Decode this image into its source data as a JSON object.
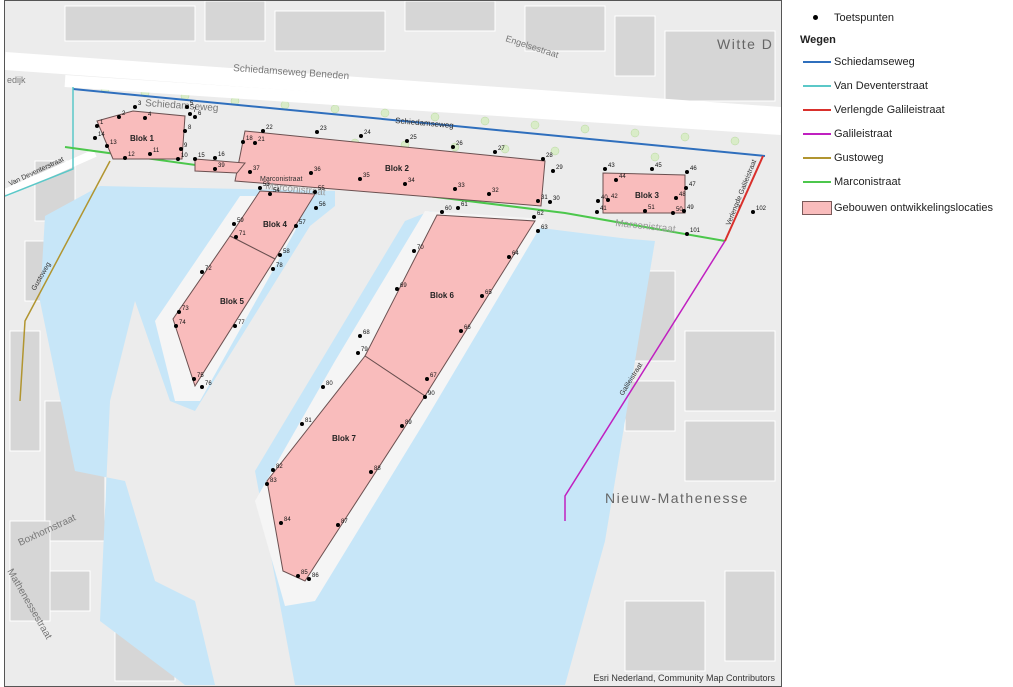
{
  "map": {
    "attribution": "Esri Nederland, Community Map Contributors",
    "area_labels": [
      "Witte D",
      "Nieuw-Mathenesse"
    ],
    "street_labels": {
      "schiedamseweg_beneden": "Schiedamseweg Beneden",
      "schiedamseweg": "Schiedamseweg",
      "schiedamseweg_route": "Schiedamseweg",
      "engelsestraat": "Engelsestraat",
      "van_deventerstraat": "Van Deventerstraat",
      "gustoweg": "Gustoweg",
      "marconistraat": "Marconistraat",
      "marconistraat2": "Marconistraat",
      "marconistraat3": "Marconistraat",
      "galileistraat": "Galileistraat",
      "verlengde_galileistraat": "Verlengde Galileistraat",
      "boxhornstraat": "Boxhornstraat",
      "mathenessestraat": "Mathenessestraat",
      "dijk": "edijk"
    },
    "buildings": [
      {
        "name": "Blok 1"
      },
      {
        "name": "Blok 2"
      },
      {
        "name": "Blok 3"
      },
      {
        "name": "Blok 4"
      },
      {
        "name": "Blok 5"
      },
      {
        "name": "Blok 6"
      },
      {
        "name": "Blok 7"
      }
    ],
    "test_points": [
      "1",
      "2",
      "3",
      "4",
      "5",
      "6",
      "7",
      "8",
      "9",
      "10",
      "11",
      "12",
      "13",
      "14",
      "15",
      "16",
      "18",
      "21",
      "22",
      "23",
      "24",
      "25",
      "26",
      "27",
      "28",
      "29",
      "30",
      "31",
      "32",
      "33",
      "34",
      "35",
      "36",
      "37",
      "39",
      "40",
      "41",
      "42",
      "43",
      "44",
      "45",
      "46",
      "47",
      "48",
      "49",
      "50",
      "51",
      "53",
      "54",
      "55",
      "56",
      "57",
      "58",
      "59",
      "60",
      "61",
      "62",
      "63",
      "64",
      "65",
      "66",
      "67",
      "68",
      "69",
      "70",
      "71",
      "72",
      "73",
      "74",
      "75",
      "76",
      "77",
      "78",
      "79",
      "80",
      "81",
      "82",
      "83",
      "84",
      "85",
      "86",
      "87",
      "88",
      "89",
      "90",
      "101",
      "102"
    ]
  },
  "legend": {
    "test_points": "Toetspunten",
    "roads_header": "Wegen",
    "roads": [
      {
        "label": "Schiedamseweg",
        "color": "#2f6fbd"
      },
      {
        "label": "Van Deventerstraat",
        "color": "#5bc8c8"
      },
      {
        "label": "Verlengde Galileistraat",
        "color": "#d9302c"
      },
      {
        "label": "Galileistraat",
        "color": "#c020c0"
      },
      {
        "label": "Gustoweg",
        "color": "#b19530"
      },
      {
        "label": "Marconistraat",
        "color": "#4cc74c"
      }
    ],
    "buildings": "Gebouwen ontwikkelingslocaties",
    "building_color": "#f9bcbc"
  }
}
